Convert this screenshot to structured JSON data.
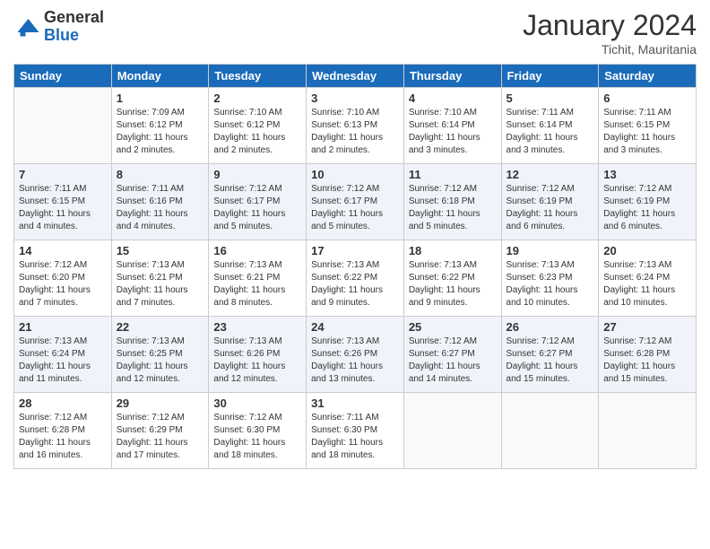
{
  "header": {
    "logo_general": "General",
    "logo_blue": "Blue",
    "month_title": "January 2024",
    "location": "Tichit, Mauritania"
  },
  "days_of_week": [
    "Sunday",
    "Monday",
    "Tuesday",
    "Wednesday",
    "Thursday",
    "Friday",
    "Saturday"
  ],
  "weeks": [
    [
      {
        "day": "",
        "sunrise": "",
        "sunset": "",
        "daylight": ""
      },
      {
        "day": "1",
        "sunrise": "Sunrise: 7:09 AM",
        "sunset": "Sunset: 6:12 PM",
        "daylight": "Daylight: 11 hours and 2 minutes."
      },
      {
        "day": "2",
        "sunrise": "Sunrise: 7:10 AM",
        "sunset": "Sunset: 6:12 PM",
        "daylight": "Daylight: 11 hours and 2 minutes."
      },
      {
        "day": "3",
        "sunrise": "Sunrise: 7:10 AM",
        "sunset": "Sunset: 6:13 PM",
        "daylight": "Daylight: 11 hours and 2 minutes."
      },
      {
        "day": "4",
        "sunrise": "Sunrise: 7:10 AM",
        "sunset": "Sunset: 6:14 PM",
        "daylight": "Daylight: 11 hours and 3 minutes."
      },
      {
        "day": "5",
        "sunrise": "Sunrise: 7:11 AM",
        "sunset": "Sunset: 6:14 PM",
        "daylight": "Daylight: 11 hours and 3 minutes."
      },
      {
        "day": "6",
        "sunrise": "Sunrise: 7:11 AM",
        "sunset": "Sunset: 6:15 PM",
        "daylight": "Daylight: 11 hours and 3 minutes."
      }
    ],
    [
      {
        "day": "7",
        "sunrise": "Sunrise: 7:11 AM",
        "sunset": "Sunset: 6:15 PM",
        "daylight": "Daylight: 11 hours and 4 minutes."
      },
      {
        "day": "8",
        "sunrise": "Sunrise: 7:11 AM",
        "sunset": "Sunset: 6:16 PM",
        "daylight": "Daylight: 11 hours and 4 minutes."
      },
      {
        "day": "9",
        "sunrise": "Sunrise: 7:12 AM",
        "sunset": "Sunset: 6:17 PM",
        "daylight": "Daylight: 11 hours and 5 minutes."
      },
      {
        "day": "10",
        "sunrise": "Sunrise: 7:12 AM",
        "sunset": "Sunset: 6:17 PM",
        "daylight": "Daylight: 11 hours and 5 minutes."
      },
      {
        "day": "11",
        "sunrise": "Sunrise: 7:12 AM",
        "sunset": "Sunset: 6:18 PM",
        "daylight": "Daylight: 11 hours and 5 minutes."
      },
      {
        "day": "12",
        "sunrise": "Sunrise: 7:12 AM",
        "sunset": "Sunset: 6:19 PM",
        "daylight": "Daylight: 11 hours and 6 minutes."
      },
      {
        "day": "13",
        "sunrise": "Sunrise: 7:12 AM",
        "sunset": "Sunset: 6:19 PM",
        "daylight": "Daylight: 11 hours and 6 minutes."
      }
    ],
    [
      {
        "day": "14",
        "sunrise": "Sunrise: 7:12 AM",
        "sunset": "Sunset: 6:20 PM",
        "daylight": "Daylight: 11 hours and 7 minutes."
      },
      {
        "day": "15",
        "sunrise": "Sunrise: 7:13 AM",
        "sunset": "Sunset: 6:21 PM",
        "daylight": "Daylight: 11 hours and 7 minutes."
      },
      {
        "day": "16",
        "sunrise": "Sunrise: 7:13 AM",
        "sunset": "Sunset: 6:21 PM",
        "daylight": "Daylight: 11 hours and 8 minutes."
      },
      {
        "day": "17",
        "sunrise": "Sunrise: 7:13 AM",
        "sunset": "Sunset: 6:22 PM",
        "daylight": "Daylight: 11 hours and 9 minutes."
      },
      {
        "day": "18",
        "sunrise": "Sunrise: 7:13 AM",
        "sunset": "Sunset: 6:22 PM",
        "daylight": "Daylight: 11 hours and 9 minutes."
      },
      {
        "day": "19",
        "sunrise": "Sunrise: 7:13 AM",
        "sunset": "Sunset: 6:23 PM",
        "daylight": "Daylight: 11 hours and 10 minutes."
      },
      {
        "day": "20",
        "sunrise": "Sunrise: 7:13 AM",
        "sunset": "Sunset: 6:24 PM",
        "daylight": "Daylight: 11 hours and 10 minutes."
      }
    ],
    [
      {
        "day": "21",
        "sunrise": "Sunrise: 7:13 AM",
        "sunset": "Sunset: 6:24 PM",
        "daylight": "Daylight: 11 hours and 11 minutes."
      },
      {
        "day": "22",
        "sunrise": "Sunrise: 7:13 AM",
        "sunset": "Sunset: 6:25 PM",
        "daylight": "Daylight: 11 hours and 12 minutes."
      },
      {
        "day": "23",
        "sunrise": "Sunrise: 7:13 AM",
        "sunset": "Sunset: 6:26 PM",
        "daylight": "Daylight: 11 hours and 12 minutes."
      },
      {
        "day": "24",
        "sunrise": "Sunrise: 7:13 AM",
        "sunset": "Sunset: 6:26 PM",
        "daylight": "Daylight: 11 hours and 13 minutes."
      },
      {
        "day": "25",
        "sunrise": "Sunrise: 7:12 AM",
        "sunset": "Sunset: 6:27 PM",
        "daylight": "Daylight: 11 hours and 14 minutes."
      },
      {
        "day": "26",
        "sunrise": "Sunrise: 7:12 AM",
        "sunset": "Sunset: 6:27 PM",
        "daylight": "Daylight: 11 hours and 15 minutes."
      },
      {
        "day": "27",
        "sunrise": "Sunrise: 7:12 AM",
        "sunset": "Sunset: 6:28 PM",
        "daylight": "Daylight: 11 hours and 15 minutes."
      }
    ],
    [
      {
        "day": "28",
        "sunrise": "Sunrise: 7:12 AM",
        "sunset": "Sunset: 6:28 PM",
        "daylight": "Daylight: 11 hours and 16 minutes."
      },
      {
        "day": "29",
        "sunrise": "Sunrise: 7:12 AM",
        "sunset": "Sunset: 6:29 PM",
        "daylight": "Daylight: 11 hours and 17 minutes."
      },
      {
        "day": "30",
        "sunrise": "Sunrise: 7:12 AM",
        "sunset": "Sunset: 6:30 PM",
        "daylight": "Daylight: 11 hours and 18 minutes."
      },
      {
        "day": "31",
        "sunrise": "Sunrise: 7:11 AM",
        "sunset": "Sunset: 6:30 PM",
        "daylight": "Daylight: 11 hours and 18 minutes."
      },
      {
        "day": "",
        "sunrise": "",
        "sunset": "",
        "daylight": ""
      },
      {
        "day": "",
        "sunrise": "",
        "sunset": "",
        "daylight": ""
      },
      {
        "day": "",
        "sunrise": "",
        "sunset": "",
        "daylight": ""
      }
    ]
  ]
}
